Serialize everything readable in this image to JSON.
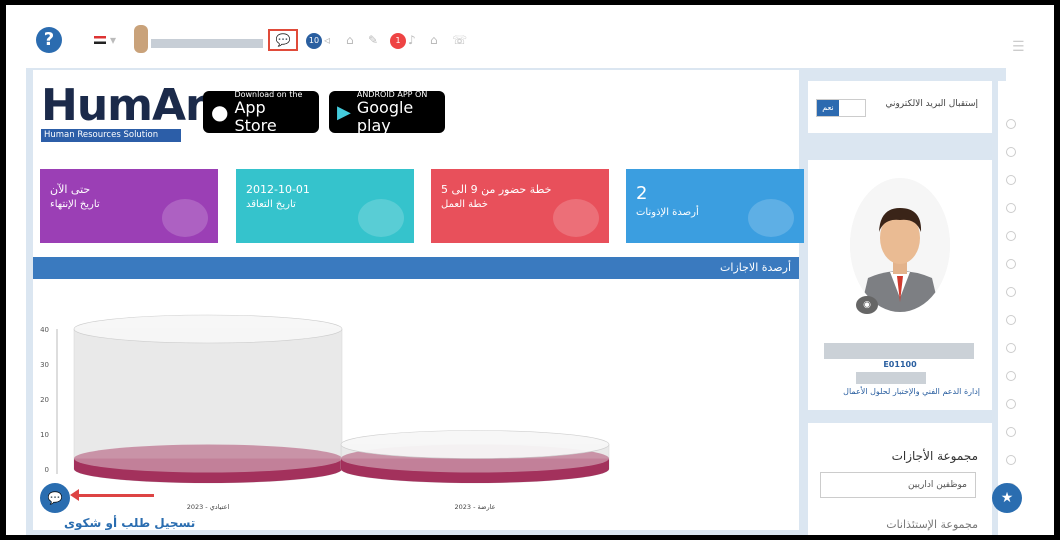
{
  "topbar": {
    "help_icon": "question-icon",
    "chat_badge": "10",
    "alert_badge": "1"
  },
  "logo": {
    "word": "HumAn",
    "subtitle": "Human Resources Solution"
  },
  "stores": [
    {
      "line1": "Download on the",
      "line2": "App Store"
    },
    {
      "line1": "ANDROID APP ON",
      "line2": "Google play"
    }
  ],
  "tiles": [
    {
      "value": "حتى الآن",
      "label": "تاريخ الإنتهاء",
      "color": "#9b3fb5"
    },
    {
      "value": "2012-10-01",
      "label": "تاريخ التعاقد",
      "color": "#35c3cc"
    },
    {
      "value": "خطة حضور من 9 الى 5",
      "label": "خطة العمل",
      "color": "#e8505b"
    },
    {
      "value": "2",
      "label": "أرصدة الإذونات",
      "color": "#3b9ee0"
    }
  ],
  "section_title": "أرصدة الاجازات",
  "chart_data": {
    "type": "bar",
    "categories": [
      "اعتيادي - 2023",
      "عارضة - 2023"
    ],
    "series": [
      {
        "values": [
          40,
          7
        ]
      },
      {
        "values": [
          3,
          3
        ]
      }
    ],
    "yticks": [
      "0",
      "10",
      "20",
      "30",
      "40"
    ],
    "ylim": [
      0,
      40
    ]
  },
  "email_panel": {
    "label": "إستقبال البريد الالكتروني",
    "toggle": "نعم"
  },
  "profile": {
    "emp_id": "E01100",
    "department": "إدارة الدعم الفني والإختبار لحلول الأعمال"
  },
  "vacation_panel": {
    "title": "مجموعة الأجازات",
    "select_value": "موظفين اداريين",
    "next_title": "مجموعة الإستئذانات"
  },
  "register_label": "تسجيل طلب أو شكوى"
}
